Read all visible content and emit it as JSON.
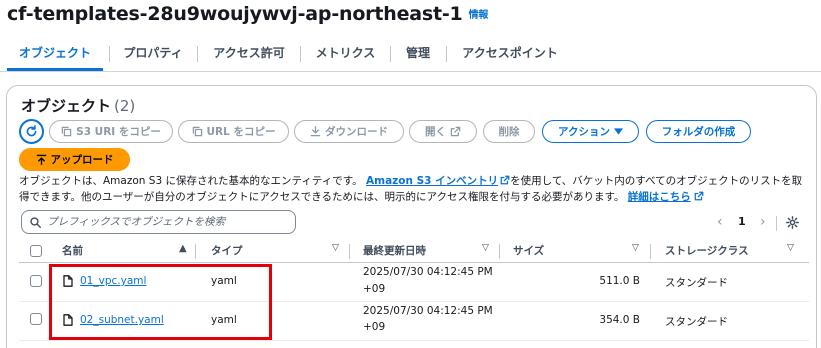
{
  "header": {
    "title": "cf-templates-28u9woujywvj-ap-northeast-1",
    "info_label": "情報"
  },
  "tabs": [
    {
      "label": "オブジェクト",
      "active": true
    },
    {
      "label": "プロパティ",
      "active": false
    },
    {
      "label": "アクセス許可",
      "active": false
    },
    {
      "label": "メトリクス",
      "active": false
    },
    {
      "label": "管理",
      "active": false
    },
    {
      "label": "アクセスポイント",
      "active": false
    }
  ],
  "objects_panel": {
    "title": "オブジェクト",
    "count": "(2)",
    "toolbar": {
      "copy_s3_uri": "S3 URI をコピー",
      "copy_url": "URL をコピー",
      "download": "ダウンロード",
      "open": "開く",
      "delete": "削除",
      "actions": "アクション",
      "create_folder": "フォルダの作成",
      "upload": "アップロード"
    },
    "description": {
      "part1": "オブジェクトは、Amazon S3 に保存された基本的なエンティティです。",
      "inventory_link": "Amazon S3 インベントリ",
      "part2": "を使用して、バケット内のすべてのオブジェクトのリストを取得できます。他のユーザーが自分のオブジェクトにアクセスできるためには、明示的にアクセス権限を付与する必要があります。",
      "learn_more_link": "詳細はこちら"
    },
    "search": {
      "placeholder": "プレフィックスでオブジェクトを検索",
      "value": ""
    },
    "pagination": {
      "current_page": "1"
    },
    "table": {
      "columns": [
        "名前",
        "タイプ",
        "最終更新日時",
        "サイズ",
        "ストレージクラス"
      ],
      "rows": [
        {
          "name": "01_vpc.yaml",
          "type": "yaml",
          "modified_line1": "2025/07/30 04:12:45 PM",
          "modified_line2": "+09",
          "size": "511.0 B",
          "storage_class": "スタンダード"
        },
        {
          "name": "02_subnet.yaml",
          "type": "yaml",
          "modified_line1": "2025/07/30 04:12:45 PM",
          "modified_line2": "+09",
          "size": "354.0 B",
          "storage_class": "スタンダード"
        }
      ]
    }
  },
  "colors": {
    "accent": "#0972d3",
    "primary_button": "#ff9900",
    "highlight_box": "#e3000b"
  }
}
